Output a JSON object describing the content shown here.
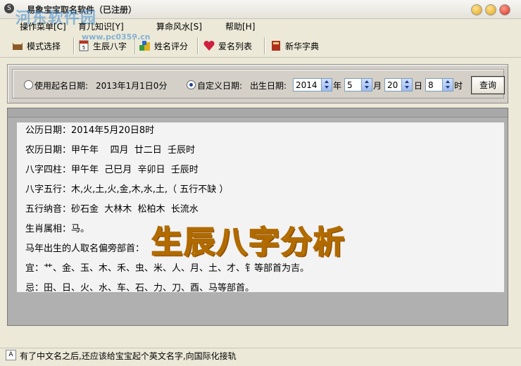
{
  "window": {
    "title": "易象宝宝取名软件（已注册）",
    "watermark": "河东软件园",
    "watermark_url": "www.pc0359.cn"
  },
  "menu": {
    "items": [
      {
        "label": "操作菜单[C]"
      },
      {
        "label": "育儿知识[Y]"
      },
      {
        "label": "算命风水[S]"
      },
      {
        "label": "帮助[H]"
      }
    ]
  },
  "toolbar": {
    "buttons": [
      {
        "label": "模式选择",
        "icon": "book-icon"
      },
      {
        "label": "生辰八字",
        "icon": "almanac-icon"
      },
      {
        "label": "姓名评分",
        "icon": "blocks-icon"
      },
      {
        "label": "爱名列表",
        "icon": "heart-icon"
      },
      {
        "label": "新华字典",
        "icon": "dictionary-icon"
      }
    ]
  },
  "date_panel": {
    "option_start_label": "使用起名日期:",
    "start_date_value": "2013年1月1日0分",
    "option_custom_label": "自定义日期:",
    "birth_label": "出生日期:",
    "year": "2014",
    "year_unit": "年",
    "month": "5",
    "month_unit": "月",
    "day": "20",
    "day_unit": "日",
    "hour": "8",
    "hour_unit": "时",
    "query_label": "查询",
    "selected": "custom"
  },
  "result": {
    "lines": [
      "公历日期：2014年5月20日8时",
      "农历日期：甲午年    四月  廿二日  壬辰时",
      "八字四柱：甲午年  己巳月  辛卯日  壬辰时",
      "八字五行：木,火,土,火,金,木,水,土,（ 五行不缺 ）",
      "五行纳音：砂石金  大林木  松柏木  长流水",
      "生肖属相：马。",
      "马年出生的人取名偏旁部首：",
      "宜：艹、金、玉、木、禾、虫、米、人、月、土、才、钅等部首为吉。",
      "忌：田、日、火、水、车、石、力、刀、酉、马等部首。"
    ],
    "overlay_title": "生辰八字分析"
  },
  "status": {
    "text": "有了中文名之后,还应该给宝宝起个英文名字,向国际化接轨"
  }
}
